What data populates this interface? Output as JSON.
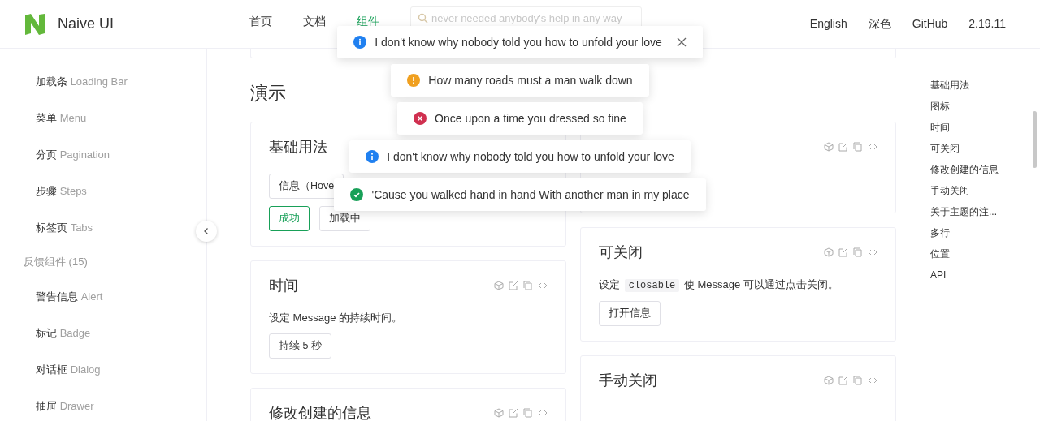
{
  "header": {
    "logo_text": "Naive UI",
    "nav": [
      {
        "label": "首页",
        "selected": false
      },
      {
        "label": "文档",
        "selected": false
      },
      {
        "label": "组件",
        "selected": true
      }
    ],
    "search": {
      "placeholder": "never needed anybody's help in any way"
    },
    "links": [
      "English",
      "深色",
      "GitHub",
      "2.19.11"
    ]
  },
  "sidebar": {
    "items": [
      {
        "kind": "item",
        "label": "加载条",
        "en": "Loading Bar"
      },
      {
        "kind": "item",
        "label": "菜单",
        "en": "Menu"
      },
      {
        "kind": "item",
        "label": "分页",
        "en": "Pagination"
      },
      {
        "kind": "item",
        "label": "步骤",
        "en": "Steps"
      },
      {
        "kind": "item",
        "label": "标签页",
        "en": "Tabs"
      },
      {
        "kind": "group",
        "label": "反馈组件 (15)"
      },
      {
        "kind": "item",
        "label": "警告信息",
        "en": "Alert"
      },
      {
        "kind": "item",
        "label": "标记",
        "en": "Badge"
      },
      {
        "kind": "item",
        "label": "对话框",
        "en": "Dialog"
      },
      {
        "kind": "item",
        "label": "抽屉",
        "en": "Drawer"
      }
    ]
  },
  "content": {
    "heading": "演示",
    "columns": [
      [
        {
          "title": "基础用法",
          "button_rows": [
            [
              {
                "label": "信息（Hove",
                "kind": "default"
              }
            ],
            [
              {
                "label": "成功",
                "kind": "success"
              },
              {
                "label": "加载中",
                "kind": "default"
              }
            ]
          ]
        },
        {
          "title": "时间",
          "toolbar": true,
          "description": [
            {
              "text": "设定 Message 的持续时间。",
              "code": false
            }
          ],
          "button_rows": [
            [
              {
                "label": "持续 5 秒",
                "kind": "default"
              }
            ]
          ]
        },
        {
          "title": "修改创建的信息",
          "toolbar": true
        }
      ],
      [
        {
          "toolbar": true
        },
        {
          "title": "可关闭",
          "toolbar": true,
          "description": [
            {
              "text": "设定 ",
              "code": false
            },
            {
              "text": "closable",
              "code": true
            },
            {
              "text": " 使 Message 可以通过点击关闭。",
              "code": false
            }
          ],
          "button_rows": [
            [
              {
                "label": "打开信息",
                "kind": "default"
              }
            ]
          ]
        },
        {
          "title": "手动关闭",
          "toolbar": true
        }
      ]
    ]
  },
  "anchors": [
    "基础用法",
    "图标",
    "时间",
    "可关闭",
    "修改创建的信息",
    "手动关闭",
    "关于主题的注...",
    "多行",
    "位置",
    "API"
  ],
  "messages": [
    {
      "kind": "info",
      "text": "I don't know why nobody told you how to unfold your love",
      "closable": true
    },
    {
      "kind": "warning",
      "text": "How many roads must a man walk down",
      "closable": false
    },
    {
      "kind": "error",
      "text": "Once upon a time you dressed so fine",
      "closable": false
    },
    {
      "kind": "info",
      "text": "I don't know why nobody told you how to unfold your love",
      "closable": false
    },
    {
      "kind": "success",
      "text": "'Cause you walked hand in hand With another man in my place",
      "closable": false
    }
  ]
}
